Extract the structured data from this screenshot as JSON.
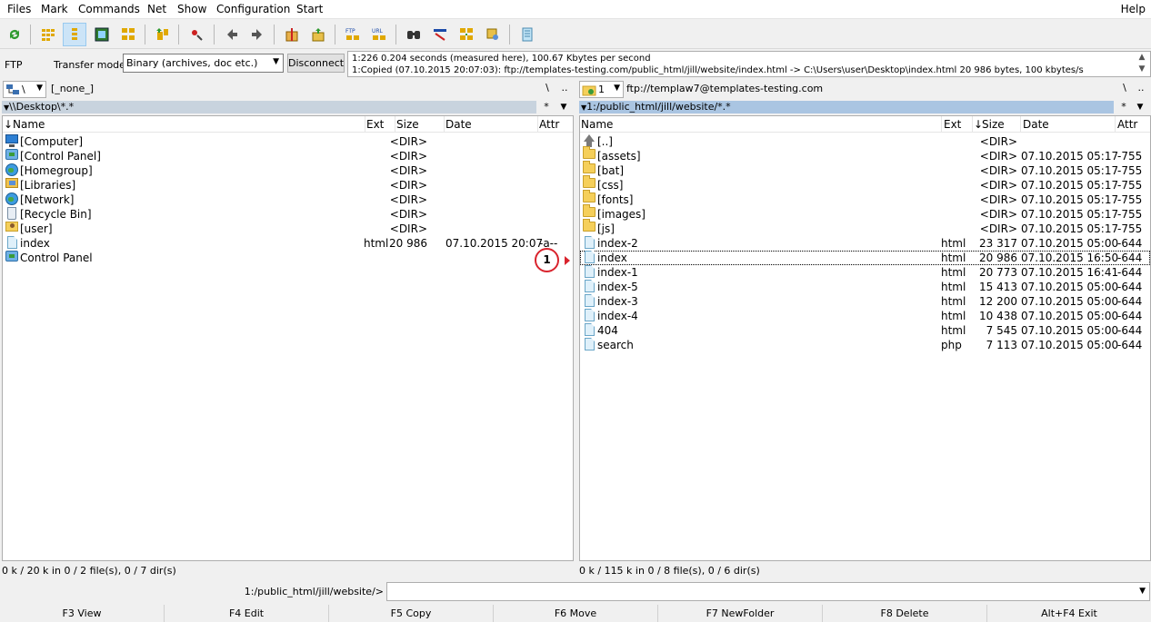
{
  "menu": {
    "items": [
      "Files",
      "Mark",
      "Commands",
      "Net",
      "Show",
      "Configuration",
      "Start"
    ],
    "help": "Help"
  },
  "toolbar": {
    "buttons": [
      "refresh-icon",
      "brief-view-icon",
      "full-view-icon",
      "thumbnails-icon",
      "tree-icon",
      "compare-dirs-icon",
      "sync-icon",
      "back-icon",
      "forward-icon",
      "pack-icon",
      "unpack-icon",
      "ftp-connect-icon",
      "url-connect-icon",
      "find-icon",
      "multi-rename-icon",
      "sync-dirs-icon",
      "compare-icon",
      "notepad-icon"
    ]
  },
  "ftp": {
    "label": "FTP",
    "transfer_mode_label": "Transfer mode",
    "transfer_mode_value": "Binary (archives, doc etc.)",
    "disconnect_label": "Disconnect",
    "log_line1": "1:226 0.204 seconds (measured here), 100.67 Kbytes per second",
    "log_line2": "1:Copied (07.10.2015 20:07:03): ftp://templates-testing.com/public_html/jill/website/index.html -> C:\\Users\\user\\Desktop\\index.html 20 986 bytes, 100 kbytes/s"
  },
  "left": {
    "drive": "\\",
    "drive_info": "[_none_]",
    "nav_root": "\\",
    "nav_up": "..",
    "path": "\\\\Desktop\\*.*",
    "star": "*",
    "columns": {
      "name": "Name",
      "ext": "Ext",
      "size": "Size",
      "date": "Date",
      "attr": "Attr"
    },
    "rows": [
      {
        "icon": "computer-icon",
        "name": "[Computer]",
        "ext": "",
        "size": "<DIR>",
        "date": "",
        "attr": ""
      },
      {
        "icon": "control-panel-icon",
        "name": "[Control Panel]",
        "ext": "",
        "size": "<DIR>",
        "date": "",
        "attr": ""
      },
      {
        "icon": "homegroup-icon",
        "name": "[Homegroup]",
        "ext": "",
        "size": "<DIR>",
        "date": "",
        "attr": ""
      },
      {
        "icon": "libraries-icon",
        "name": "[Libraries]",
        "ext": "",
        "size": "<DIR>",
        "date": "",
        "attr": ""
      },
      {
        "icon": "network-icon",
        "name": "[Network]",
        "ext": "",
        "size": "<DIR>",
        "date": "",
        "attr": ""
      },
      {
        "icon": "recycle-bin-icon",
        "name": "[Recycle Bin]",
        "ext": "",
        "size": "<DIR>",
        "date": "",
        "attr": ""
      },
      {
        "icon": "user-folder-icon",
        "name": "[user]",
        "ext": "",
        "size": "<DIR>",
        "date": "",
        "attr": ""
      },
      {
        "icon": "file-icon",
        "name": "index",
        "ext": "html",
        "size": "20 986",
        "date": "07.10.2015 20:07",
        "attr": "-a--"
      },
      {
        "icon": "control-panel-icon",
        "name": "Control Panel",
        "ext": "",
        "size": "",
        "date": "",
        "attr": ""
      }
    ],
    "status": "0 k / 20 k in 0 / 2 file(s), 0 / 7 dir(s)"
  },
  "right": {
    "drive": "1",
    "drive_info": "ftp://templaw7@templates-testing.com",
    "nav_root": "\\",
    "nav_up": "..",
    "path": "1:/public_html/jill/website/*.*",
    "star": "*",
    "columns": {
      "name": "Name",
      "ext": "Ext",
      "size": "Size",
      "date": "Date",
      "attr": "Attr"
    },
    "rows": [
      {
        "icon": "up-dir-icon",
        "name": "[..]",
        "ext": "",
        "size": "<DIR>",
        "date": "",
        "attr": ""
      },
      {
        "icon": "folder-icon",
        "name": "[assets]",
        "ext": "",
        "size": "<DIR>",
        "date": "07.10.2015 05:17",
        "attr": "-755"
      },
      {
        "icon": "folder-icon",
        "name": "[bat]",
        "ext": "",
        "size": "<DIR>",
        "date": "07.10.2015 05:17",
        "attr": "-755"
      },
      {
        "icon": "folder-icon",
        "name": "[css]",
        "ext": "",
        "size": "<DIR>",
        "date": "07.10.2015 05:17",
        "attr": "-755"
      },
      {
        "icon": "folder-icon",
        "name": "[fonts]",
        "ext": "",
        "size": "<DIR>",
        "date": "07.10.2015 05:17",
        "attr": "-755"
      },
      {
        "icon": "folder-icon",
        "name": "[images]",
        "ext": "",
        "size": "<DIR>",
        "date": "07.10.2015 05:17",
        "attr": "-755"
      },
      {
        "icon": "folder-icon",
        "name": "[js]",
        "ext": "",
        "size": "<DIR>",
        "date": "07.10.2015 05:17",
        "attr": "-755"
      },
      {
        "icon": "file-icon",
        "name": "index-2",
        "ext": "html",
        "size": "23 317",
        "date": "07.10.2015 05:00",
        "attr": "-644"
      },
      {
        "icon": "file-icon",
        "name": "index",
        "ext": "html",
        "size": "20 986",
        "date": "07.10.2015 16:50",
        "attr": "-644"
      },
      {
        "icon": "file-icon",
        "name": "index-1",
        "ext": "html",
        "size": "20 773",
        "date": "07.10.2015 16:41",
        "attr": "-644"
      },
      {
        "icon": "file-icon",
        "name": "index-5",
        "ext": "html",
        "size": "15 413",
        "date": "07.10.2015 05:00",
        "attr": "-644"
      },
      {
        "icon": "file-icon",
        "name": "index-3",
        "ext": "html",
        "size": "12 200",
        "date": "07.10.2015 05:00",
        "attr": "-644"
      },
      {
        "icon": "file-icon",
        "name": "index-4",
        "ext": "html",
        "size": "10 438",
        "date": "07.10.2015 05:00",
        "attr": "-644"
      },
      {
        "icon": "file-icon",
        "name": "404",
        "ext": "html",
        "size": "7 545",
        "date": "07.10.2015 05:00",
        "attr": "-644"
      },
      {
        "icon": "file-icon",
        "name": "search",
        "ext": "php",
        "size": "7 113",
        "date": "07.10.2015 05:00",
        "attr": "-644"
      }
    ],
    "focused_index": 8,
    "status": "0 k / 115 k in 0 / 8 file(s), 0 / 6 dir(s)"
  },
  "cmdline": {
    "path": "1:/public_html/jill/website/>",
    "value": ""
  },
  "fkeys": [
    "F3 View",
    "F4 Edit",
    "F5 Copy",
    "F6 Move",
    "F7 NewFolder",
    "F8 Delete",
    "Alt+F4 Exit"
  ],
  "annotation": {
    "label": "1",
    "color": "#d9232d"
  }
}
